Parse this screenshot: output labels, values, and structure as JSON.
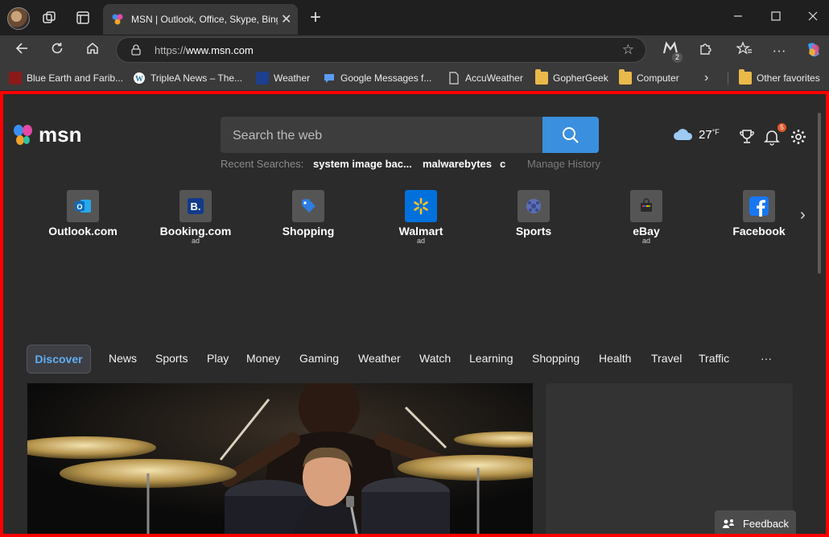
{
  "browser": {
    "tab_title": "MSN | Outlook, Office, Skype, Bing",
    "tab_close": "✕",
    "new_tab": "+",
    "url_prefix": "https://",
    "url_host": "www.msn.com",
    "extension_badge": "2",
    "window_controls": [
      "minimize-icon",
      "maximize-icon",
      "close-icon"
    ]
  },
  "favorites": {
    "items": [
      {
        "label": "Blue Earth and Farib...",
        "icon": "video-icon"
      },
      {
        "label": "TripleA News – The...",
        "icon": "wordpress-icon"
      },
      {
        "label": "Weather",
        "icon": "weather-site-icon"
      },
      {
        "label": "Google Messages f...",
        "icon": "messages-icon"
      },
      {
        "label": "AccuWeather",
        "icon": "page-icon"
      },
      {
        "label": "GopherGeek",
        "icon": "folder-icon"
      },
      {
        "label": "Computer",
        "icon": "folder-icon"
      }
    ],
    "other": "Other favorites"
  },
  "msn": {
    "logo_text": "msn",
    "search_placeholder": "Search the web",
    "recent_label": "Recent Searches:",
    "recent_queries": [
      "system image bac...",
      "malwarebytes",
      "c"
    ],
    "manage_history": "Manage History",
    "weather": {
      "temp": "27",
      "unit": "°F",
      "icon": "cloud-icon"
    },
    "notification_count": "5",
    "quick_links": [
      {
        "name": "Outlook.com",
        "ad": "",
        "icon": "outlook-icon",
        "color": "#0f6cbd"
      },
      {
        "name": "Booking.com",
        "ad": "ad",
        "icon": "booking-icon",
        "color": "#123a8c"
      },
      {
        "name": "Shopping",
        "ad": "",
        "icon": "shopping-tag-icon",
        "color": "#2f7de1"
      },
      {
        "name": "Walmart",
        "ad": "ad",
        "icon": "walmart-icon",
        "color": "#0071dc"
      },
      {
        "name": "Sports",
        "ad": "",
        "icon": "sports-ball-icon",
        "color": "#5b6fb5"
      },
      {
        "name": "eBay",
        "ad": "ad",
        "icon": "ebay-icon",
        "color": "#e53238"
      },
      {
        "name": "Facebook",
        "ad": "",
        "icon": "facebook-icon",
        "color": "#1877f2"
      }
    ],
    "categories": [
      "Discover",
      "News",
      "Sports",
      "Play",
      "Money",
      "Gaming",
      "Weather",
      "Watch",
      "Learning",
      "Shopping",
      "Health",
      "Travel",
      "Traffic",
      "···"
    ],
    "feedback": "Feedback"
  },
  "colors": {
    "accent": "#3b8fdf",
    "discover_text": "#62aef2",
    "frame": "#ff0000"
  }
}
